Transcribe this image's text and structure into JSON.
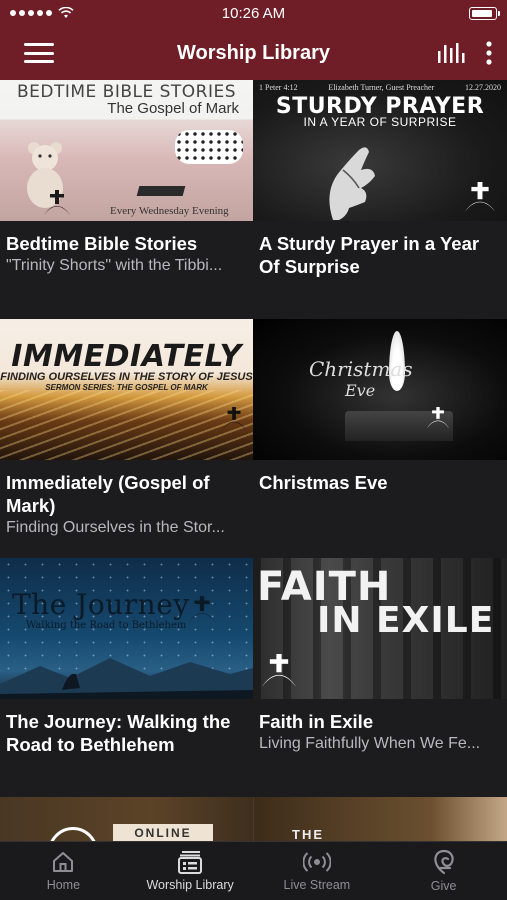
{
  "status_bar": {
    "time": "10:26 AM"
  },
  "header": {
    "title": "Worship Library"
  },
  "items": [
    {
      "title": "Bedtime Bible Stories",
      "subtitle": "\"Trinity Shorts\" with the Tibbi...",
      "thumb": {
        "line1": "BEDTIME BIBLE STORIES",
        "line2": "The Gospel of Mark",
        "footer": "Every Wednesday Evening"
      }
    },
    {
      "title": "A Sturdy Prayer in a Year Of Surprise",
      "subtitle": "",
      "thumb": {
        "meta_left": "1 Peter 4:12",
        "meta_mid": "Elizabeth Turner, Guest Preacher",
        "meta_right": "12.27.2020",
        "line1": "STURDY PRAYER",
        "line2": "IN A YEAR OF SURPRISE"
      }
    },
    {
      "title": "Immediately (Gospel of Mark)",
      "subtitle": "Finding Ourselves in the Stor...",
      "thumb": {
        "line1": "IMMEDIATELY",
        "line2": "FINDING OURSELVES IN THE STORY OF JESUS",
        "line3": "SERMON SERIES: THE GOSPEL OF MARK"
      }
    },
    {
      "title": "Christmas Eve",
      "subtitle": "",
      "thumb": {
        "line1": "Christmas",
        "line2": "Eve"
      }
    },
    {
      "title": "The Journey: Walking the Road to Bethlehem",
      "subtitle": "",
      "thumb": {
        "line1": "The Journey",
        "line2": "Walking the Road to Bethlehem"
      }
    },
    {
      "title": "Faith in Exile",
      "subtitle": "Living Faithfully When We Fe...",
      "thumb": {
        "line1": "FAITH",
        "line2": "IN EXILE"
      }
    }
  ],
  "partial": {
    "tag": "ONLINE",
    "the": "THE"
  },
  "tabs": [
    {
      "label": "Home",
      "icon": "home-icon",
      "active": false
    },
    {
      "label": "Worship Library",
      "icon": "library-icon",
      "active": true
    },
    {
      "label": "Live Stream",
      "icon": "live-stream-icon",
      "active": false
    },
    {
      "label": "Give",
      "icon": "give-icon",
      "active": false
    }
  ],
  "colors": {
    "header_bg": "#6f1d26",
    "background": "#1c1c1e",
    "tab_bar_bg": "#1a1a1c",
    "subtitle": "#b8b8bc"
  }
}
